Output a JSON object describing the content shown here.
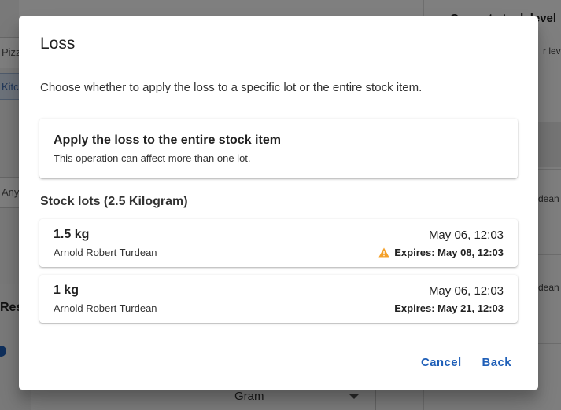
{
  "background": {
    "field_1": "Pizza",
    "chip": "Kitchen",
    "field_2": "Any pro",
    "section_title": "Rese",
    "unit_select": "Gram",
    "right_title": "Current stock level",
    "right_sub": "r level",
    "right_card_1": "dean",
    "right_card_2": "dean"
  },
  "dialog": {
    "title": "Loss",
    "description": "Choose whether to apply the loss to a specific lot or the entire stock item.",
    "entire": {
      "title": "Apply the loss to the entire stock item",
      "subtitle": "This operation can affect more than one lot."
    },
    "lots_title": "Stock lots (2.5 Kilogram)",
    "lots": [
      {
        "quantity": "1.5 kg",
        "user": "Arnold Robert Turdean",
        "date": "May 06, 12:03",
        "expires": "Expires: May 08, 12:03",
        "warning": true
      },
      {
        "quantity": "1 kg",
        "user": "Arnold Robert Turdean",
        "date": "May 06, 12:03",
        "expires": "Expires: May 21, 12:03",
        "warning": false
      }
    ],
    "actions": {
      "cancel": "Cancel",
      "back": "Back"
    }
  },
  "colors": {
    "accent": "#1f5fb8",
    "warning": "#f4a028"
  }
}
